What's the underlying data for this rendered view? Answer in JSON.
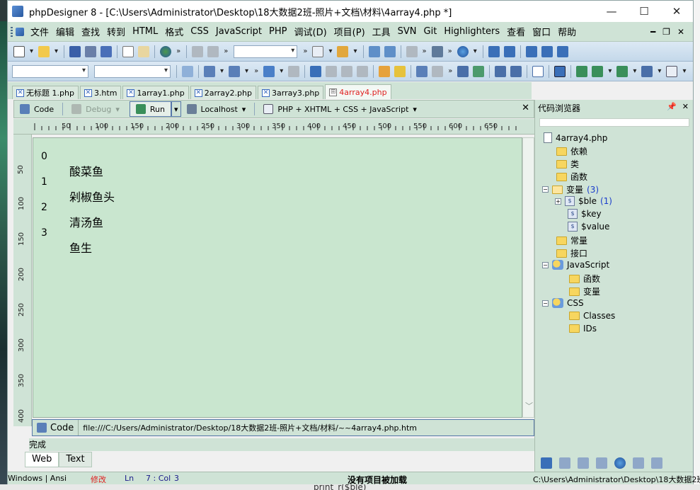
{
  "window": {
    "title": "phpDesigner 8 - [C:\\Users\\Administrator\\Desktop\\18大数据2班-照片+文档\\材料\\4array4.php *]",
    "controls": [
      "minimize",
      "maximize",
      "close"
    ]
  },
  "menubar": {
    "items": [
      "文件",
      "编辑",
      "查找",
      "转到",
      "HTML",
      "格式",
      "CSS",
      "JavaScript",
      "PHP",
      "调试(D)",
      "项目(P)",
      "工具",
      "SVN",
      "Git",
      "Highlighters",
      "查看",
      "窗口",
      "帮助"
    ]
  },
  "doc_tabs": [
    {
      "label": "无标题 1.php",
      "active": false
    },
    {
      "label": "3.htm",
      "active": false
    },
    {
      "label": "1array1.php",
      "active": false
    },
    {
      "label": "2array2.php",
      "active": false
    },
    {
      "label": "3array3.php",
      "active": false
    },
    {
      "label": "4array4.php",
      "active": true
    }
  ],
  "editor_toolbar": {
    "code": "Code",
    "debug": "Debug",
    "run": "Run",
    "localhost": "Localhost",
    "mode": "PHP + XHTML + CSS + JavaScript"
  },
  "ruler": {
    "h_ticks": [
      "50",
      "100",
      "150",
      "200",
      "250",
      "300",
      "350",
      "400",
      "450",
      "500",
      "550",
      "600",
      "650"
    ],
    "v_ticks": [
      "50",
      "100",
      "150",
      "200",
      "250",
      "300",
      "350",
      "400"
    ]
  },
  "output": {
    "rows": [
      {
        "index": "0",
        "value": "酸菜鱼"
      },
      {
        "index": "1",
        "value": "剁椒鱼头"
      },
      {
        "index": "2",
        "value": "清汤鱼"
      },
      {
        "index": "3",
        "value": "鱼生"
      }
    ]
  },
  "address_bar": {
    "code_label": "Code",
    "url": "file:///C:/Users/Administrator/Desktop/18大数据2班-照片+文档/材料/~~4array4.php.htm"
  },
  "status_line": "完成",
  "view_tabs": [
    "Web",
    "Text"
  ],
  "statusbar": {
    "os": "Windows | Ansi",
    "modified": "修改",
    "ln": "Ln",
    "pos": "7 : Col",
    "col": "3",
    "project": "没有项目被加载",
    "path": "C:\\Users\\Administrator\\Desktop\\18大数据2班-照"
  },
  "code_browser": {
    "title": "代码浏览器",
    "file": "4array4.php",
    "nodes": {
      "deps": "依赖",
      "classes": "类",
      "functions": "函数",
      "variables": "变量",
      "variables_count": "(3)",
      "var_ble": "$ble",
      "var_ble_count": "(1)",
      "var_key": "$key",
      "var_value": "$value",
      "constants": "常量",
      "interfaces": "接口",
      "js": "JavaScript",
      "js_functions": "函数",
      "js_variables": "变量",
      "css": "CSS",
      "css_classes": "Classes",
      "css_ids": "IDs"
    }
  },
  "background": {
    "peek_text": "print_r($ble)"
  },
  "colors": {
    "menubar": "#cfe3d6",
    "content": "#c9e6cf",
    "active_tab_text": "#e02020",
    "modified": "#e02020",
    "count": "#1a3ccc"
  }
}
